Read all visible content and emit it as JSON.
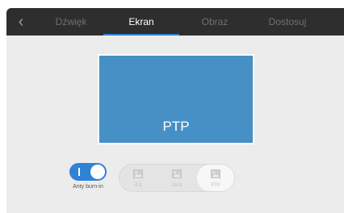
{
  "header": {
    "back_icon": "chevron-left-icon",
    "tabs": [
      {
        "label": "Dźwięk",
        "active": false
      },
      {
        "label": "Ekran",
        "active": true
      },
      {
        "label": "Obraz",
        "active": false
      },
      {
        "label": "Dostosuj",
        "active": false
      }
    ],
    "active_color": "#2f7fd0"
  },
  "preview": {
    "label": "PTP",
    "color": "#4790c6"
  },
  "anti_burn_in": {
    "label": "Anty burn-in",
    "enabled": true,
    "color": "#2f82d6"
  },
  "aspect_ratio": {
    "options": [
      {
        "label": "4:3",
        "icon": "image-icon",
        "selected": false
      },
      {
        "label": "16:9",
        "icon": "image-icon",
        "selected": false
      },
      {
        "label": "PTP",
        "icon": "image-icon",
        "selected": true
      }
    ]
  }
}
